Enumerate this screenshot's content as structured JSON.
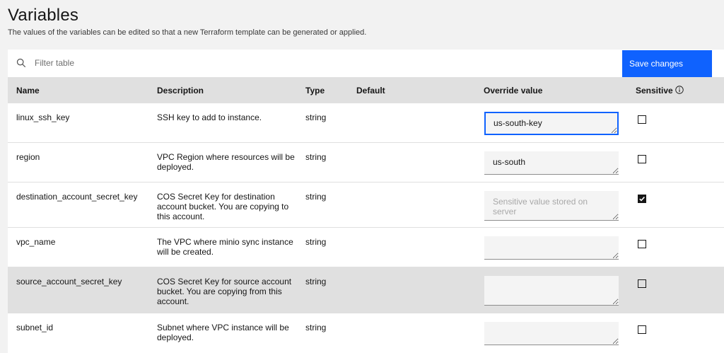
{
  "page": {
    "title": "Variables",
    "subtitle": "The values of the variables can be edited so that a new Terraform template can be generated or applied."
  },
  "toolbar": {
    "search_placeholder": "Filter table",
    "save_label": "Save changes"
  },
  "table": {
    "headers": {
      "name": "Name",
      "description": "Description",
      "type": "Type",
      "default": "Default",
      "override": "Override value",
      "sensitive": "Sensitive"
    },
    "rows": [
      {
        "name": "linux_ssh_key",
        "description": "SSH key to add to instance.",
        "type": "string",
        "default": "",
        "override": "us-south-key",
        "placeholder": "",
        "sensitive": false
      },
      {
        "name": "region",
        "description": "VPC Region where resources will be deployed.",
        "type": "string",
        "default": "",
        "override": "us-south",
        "placeholder": "",
        "sensitive": false
      },
      {
        "name": "destination_account_secret_key",
        "description": "COS Secret Key for destination account bucket. You are copying to this account.",
        "type": "string",
        "default": "",
        "override": "",
        "placeholder": "Sensitive value stored on server",
        "sensitive": true
      },
      {
        "name": "vpc_name",
        "description": "The VPC where minio sync instance will be created.",
        "type": "string",
        "default": "",
        "override": "",
        "placeholder": "",
        "sensitive": false
      },
      {
        "name": "source_account_secret_key",
        "description": "COS Secret Key for source account bucket. You are copying from this account.",
        "type": "string",
        "default": "",
        "override": "",
        "placeholder": "",
        "sensitive": false
      },
      {
        "name": "subnet_id",
        "description": "Subnet where VPC instance will be deployed.",
        "type": "string",
        "default": "",
        "override": "",
        "placeholder": "",
        "sensitive": false
      }
    ]
  },
  "colors": {
    "accent": "#0f62fe",
    "header_bg": "#e0e0e0",
    "page_bg": "#f2f2f2",
    "hover_row": "#e0e0e0"
  },
  "icons": {
    "search": "search-icon",
    "info": "information-icon",
    "check": "checkmark-icon"
  }
}
